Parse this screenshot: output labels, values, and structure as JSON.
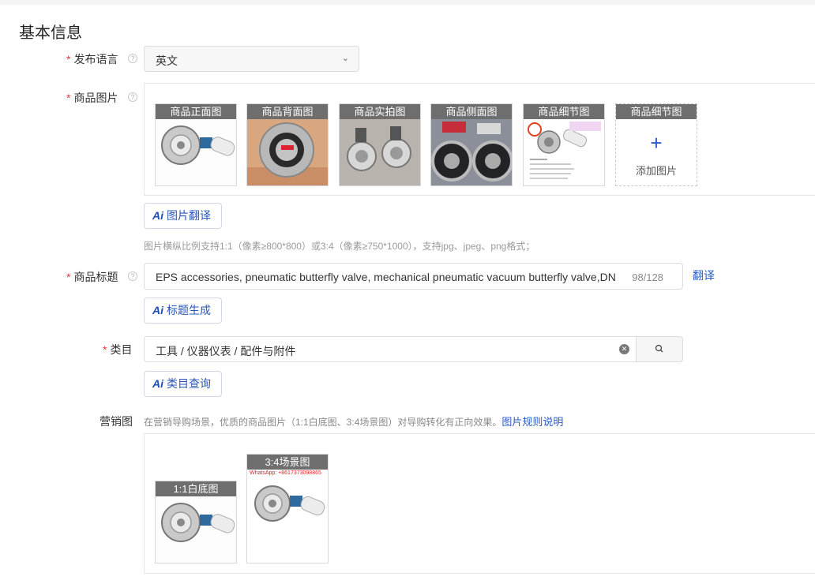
{
  "section": {
    "title": "基本信息"
  },
  "language": {
    "label": "发布语言",
    "value": "英文"
  },
  "product_images": {
    "label": "商品图片",
    "items": [
      {
        "caption": "商品正面图"
      },
      {
        "caption": "商品背面图"
      },
      {
        "caption": "商品实拍图"
      },
      {
        "caption": "商品侧面图"
      },
      {
        "caption": "商品细节图"
      }
    ],
    "add": {
      "caption": "商品细节图",
      "text": "添加图片"
    },
    "translate_btn": "图片翻译",
    "hint": "图片横纵比例支持1:1（像素≥800*800）或3:4（像素≥750*1000），支持jpg、jpeg、png格式；"
  },
  "product_title": {
    "label": "商品标题",
    "value": "EPS accessories, pneumatic butterfly valve, mechanical pneumatic vacuum butterfly valve,DN",
    "count": "98/128",
    "translate_link": "翻译",
    "generate_btn": "标题生成"
  },
  "category": {
    "label": "类目",
    "value": "工具 / 仪器仪表 / 配件与附件",
    "query_btn": "类目查询"
  },
  "marketing": {
    "label": "营销图",
    "desc": "在营销导购场景，优质的商品图片（1:1白底图、3:4场景图）对导购转化有正向效果。",
    "rule_link": "图片规则说明",
    "images": [
      {
        "caption": "1:1白底图"
      },
      {
        "caption": "3:4场景图",
        "watermark": "WhatsApp: +8617373098865"
      }
    ]
  },
  "ai_icon": "Ai"
}
